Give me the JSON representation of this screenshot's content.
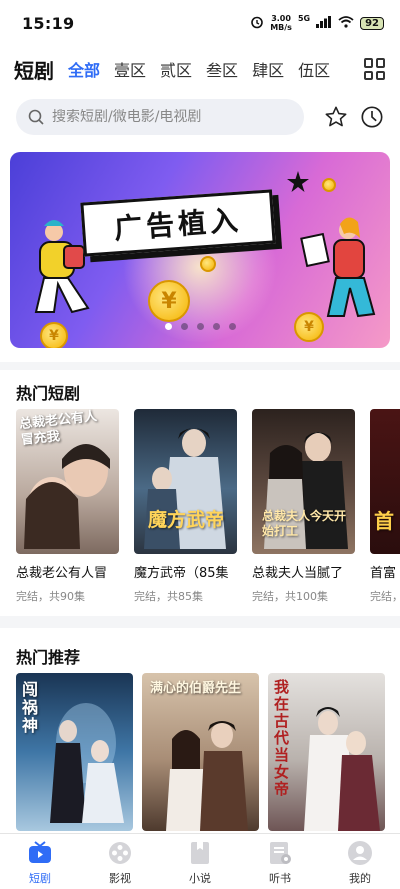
{
  "status_bar": {
    "time": "15:19",
    "net_speed_value": "3.00",
    "net_speed_unit": "MB/s",
    "network": "5G",
    "battery": "92"
  },
  "header": {
    "app_title": "短剧",
    "tabs": [
      "全部",
      "壹区",
      "贰区",
      "叁区",
      "肆区",
      "伍区"
    ],
    "active_tab": 0
  },
  "search": {
    "placeholder": "搜索短剧/微电影/电视剧"
  },
  "banner": {
    "text": "广告植入",
    "coin_symbol": "¥",
    "slide_count": 5,
    "active_slide": 0
  },
  "hot_dramas": {
    "title": "热门短剧",
    "items": [
      {
        "title": "总裁老公有人冒",
        "meta": "完结，共90集",
        "poster_text": "总裁老公有人冒充我",
        "color_top": "#e9e3df",
        "color_bottom": "#8c7b74"
      },
      {
        "title": "魔方武帝（85集",
        "meta": "完结，共85集",
        "poster_text": "魔方武帝",
        "color_top": "#2c3a4e",
        "color_bottom": "#6a8aa8"
      },
      {
        "title": "总裁夫人当腻了",
        "meta": "完结，共100集",
        "poster_text": "总裁夫人今天开始打工",
        "color_top": "#3a2a24",
        "color_bottom": "#7b6151"
      },
      {
        "title": "首富",
        "meta": "完结，共",
        "poster_text": "首",
        "color_top": "#5a1a1a",
        "color_bottom": "#2b1010"
      }
    ]
  },
  "hot_recommend": {
    "title": "热门推荐",
    "items": [
      {
        "poster_text": "闯祸神",
        "color_top": "#1f3b5a",
        "color_bottom": "#6fa0c8"
      },
      {
        "poster_text": "满心的伯爵先生",
        "color_top": "#c8b29a",
        "color_bottom": "#5a4536"
      },
      {
        "poster_text": "我在古代当女帝",
        "color_top": "#d9d6d2",
        "color_bottom": "#7a5a5a"
      }
    ]
  },
  "bottom_nav": {
    "items": [
      "短剧",
      "影视",
      "小说",
      "听书",
      "我的"
    ],
    "active": 0
  },
  "colors": {
    "accent": "#2f6cf6"
  }
}
